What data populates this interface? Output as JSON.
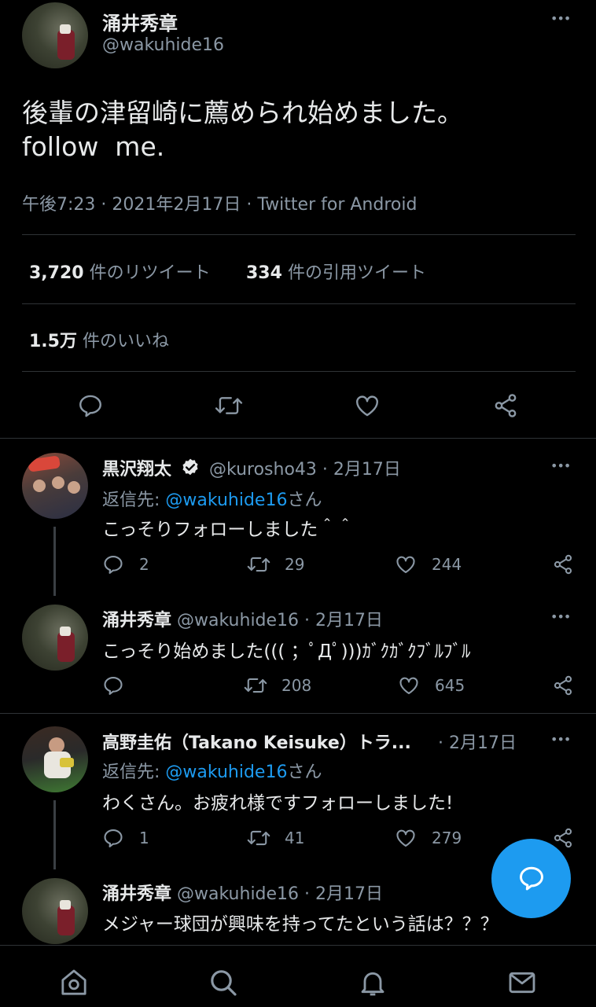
{
  "main_tweet": {
    "author_name": "涌井秀章",
    "handle": "@wakuhide16",
    "text_line1": "後輩の津留崎に薦められ始めました。",
    "text_line2": "follow  me.",
    "time": "午後7:23",
    "sep1": "·",
    "date": "2021年2月17日",
    "sep2": "·",
    "source": "Twitter for Android",
    "retweet_count": "3,720",
    "retweet_label": "件のリツイート",
    "quote_count": "334",
    "quote_label": "件の引用ツイート",
    "like_count": "1.5万",
    "like_label": "件のいいね",
    "more": "•••"
  },
  "replies": [
    {
      "name": "黒沢翔太",
      "handle": "@kurosho43",
      "meta": "· 2月17日",
      "reply_prefix": "返信先: ",
      "reply_to": "@wakuhide16",
      "reply_suffix": "さん",
      "text": "こっそりフォローしました＾＾",
      "reply_count": "2",
      "retweet_count": "29",
      "like_count": "244"
    },
    {
      "name": "涌井秀章",
      "handle": "@wakuhide16",
      "meta": "· 2月17日",
      "text": "こっそり始めました((( ；ﾟДﾟ)))ｶﾞｸｶﾞｸﾌﾞﾙﾌﾞﾙ",
      "retweet_count": "208",
      "like_count": "645"
    },
    {
      "name": "高野圭佑（Takano Keisuke）トラ...",
      "meta": "· 2月17日",
      "reply_prefix": "返信先: ",
      "reply_to": "@wakuhide16",
      "reply_suffix": "さん",
      "text": "わくさん。お疲れ様ですフォローしました!",
      "reply_count": "1",
      "retweet_count": "41",
      "like_count": "279"
    },
    {
      "name": "涌井秀章",
      "handle": "@wakuhide16",
      "meta": "· 2月17日",
      "text": "メジャー球団が興味を持ってたという話は？？？"
    }
  ],
  "more": "•••",
  "colors": {
    "accent": "#1d9bf0",
    "background": "#000000",
    "secondary_text": "#8b98a5"
  },
  "icons": [
    "reply-icon",
    "retweet-icon",
    "like-icon",
    "share-icon",
    "verified-badge-icon",
    "compose-icon",
    "home-icon",
    "search-icon",
    "notifications-icon",
    "messages-icon"
  ]
}
